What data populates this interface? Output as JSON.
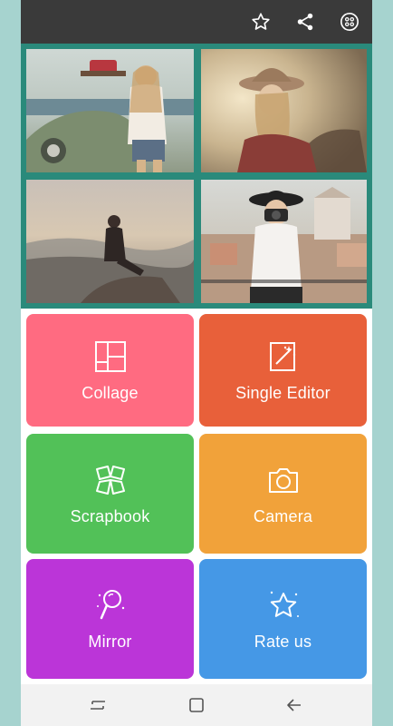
{
  "toolbar": {
    "icons": [
      "star-icon",
      "share-icon",
      "more-apps-icon"
    ]
  },
  "banner": {
    "photos": [
      "photo-woman-on-car",
      "photo-woman-in-hat",
      "photo-woman-on-rock",
      "photo-woman-with-camera"
    ]
  },
  "menu": {
    "collage": "Collage",
    "single_editor": "Single Editor",
    "scrapbook": "Scrapbook",
    "camera": "Camera",
    "mirror": "Mirror",
    "rate_us": "Rate us"
  },
  "colors": {
    "collage": "#ff6b81",
    "single_editor": "#e8603a",
    "scrapbook": "#52c158",
    "camera": "#f1a23a",
    "mirror": "#bb35d8",
    "rate_us": "#4598e6",
    "banner": "#2a8a7b",
    "toolbar": "#3a3a3a"
  },
  "navigation": {
    "icons": [
      "recent-apps-icon",
      "home-icon",
      "back-icon"
    ]
  }
}
